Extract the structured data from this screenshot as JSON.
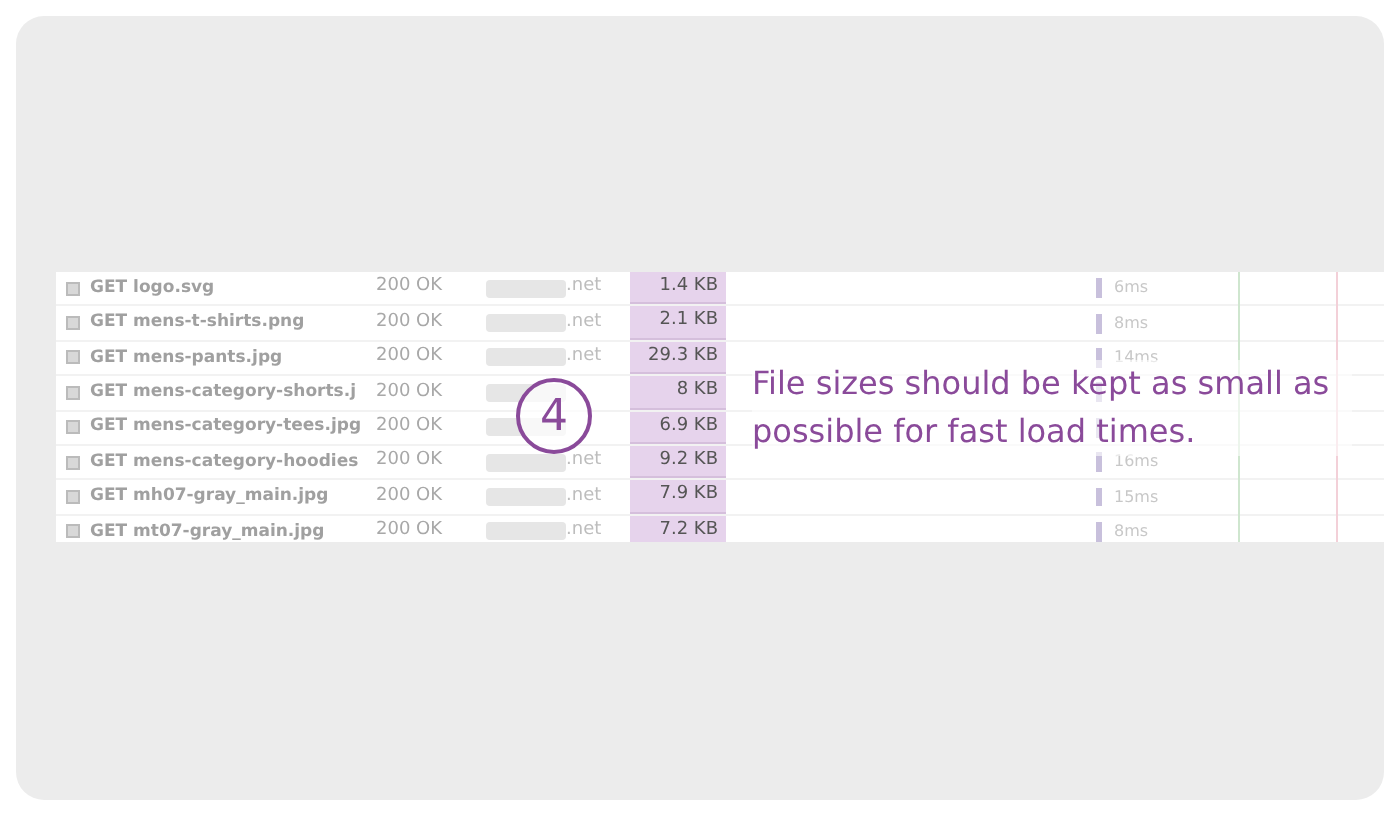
{
  "requests": [
    {
      "method": "GET",
      "file": "logo.svg",
      "status": "200 OK",
      "domain": ".net",
      "size": "1.4 KB",
      "time": "6ms"
    },
    {
      "method": "GET",
      "file": "mens-t-shirts.png",
      "status": "200 OK",
      "domain": ".net",
      "size": "2.1 KB",
      "time": "8ms"
    },
    {
      "method": "GET",
      "file": "mens-pants.jpg",
      "status": "200 OK",
      "domain": ".net",
      "size": "29.3 KB",
      "time": "14ms"
    },
    {
      "method": "GET",
      "file": "mens-category-shorts.j",
      "status": "200 OK",
      "size": "8 KB"
    },
    {
      "method": "GET",
      "file": "mens-category-tees.jpg",
      "status": "200 OK",
      "size": "6.9 KB"
    },
    {
      "method": "GET",
      "file": "mens-category-hoodies",
      "status": "200 OK",
      "domain": ".net",
      "size": "9.2 KB",
      "time": "16ms"
    },
    {
      "method": "GET",
      "file": "mh07-gray_main.jpg",
      "status": "200 OK",
      "domain": ".net",
      "size": "7.9 KB",
      "time": "15ms"
    },
    {
      "method": "GET",
      "file": "mt07-gray_main.jpg",
      "status": "200 OK",
      "domain": ".net",
      "size": "7.2 KB",
      "time": "8ms"
    }
  ],
  "callout": {
    "step": "4",
    "text": "File sizes should be kept as small as possible for fast load times."
  }
}
